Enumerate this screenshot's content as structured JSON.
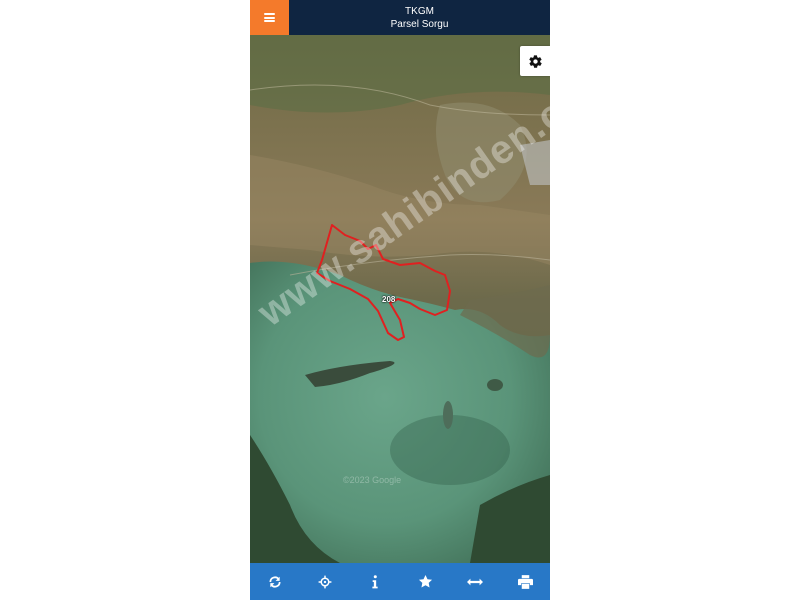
{
  "app": {
    "title": "TKGM",
    "subtitle": "Parsel Sorgu"
  },
  "header": {
    "menu_icon": "hamburger-menu-icon",
    "brand_color": "#0f2541",
    "menu_color": "#f47a2b"
  },
  "map": {
    "settings_icon": "gear-icon",
    "parcel_number": "208",
    "parcel_outline_color": "#e02020",
    "watermark_text": "www.sahibinden.com",
    "credit_text": "©2023 Google"
  },
  "toolbar": {
    "color": "#2878c7",
    "buttons": [
      {
        "icon": "refresh-icon"
      },
      {
        "icon": "crosshairs-icon"
      },
      {
        "icon": "info-icon"
      },
      {
        "icon": "star-icon"
      },
      {
        "icon": "measure-arrows-icon"
      },
      {
        "icon": "print-icon"
      }
    ]
  }
}
